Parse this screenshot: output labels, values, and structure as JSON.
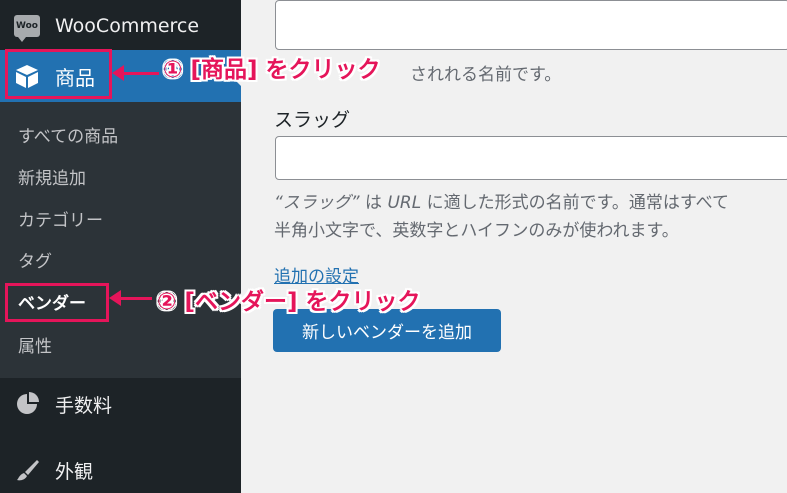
{
  "sidebar": {
    "woocommerce": {
      "badge": "Woo",
      "label": "WooCommerce"
    },
    "products": {
      "label": "商品"
    },
    "submenu": [
      {
        "label": "すべての商品"
      },
      {
        "label": "新規追加"
      },
      {
        "label": "カテゴリー"
      },
      {
        "label": "タグ"
      },
      {
        "label": "ベンダー"
      },
      {
        "label": "属性"
      }
    ],
    "fees": {
      "label": "手数料"
    },
    "appearance": {
      "label": "外観"
    }
  },
  "main": {
    "name_description": "されれる名前です。",
    "slug_label": "スラッグ",
    "slug_description": {
      "quote": "“スラッグ”",
      "p1": " は ",
      "url": "URL",
      "p2": " に適した形式の名前です。通常はすべて",
      "line2": "半角小文字で、英数字とハイフンのみが使われます。"
    },
    "advanced_link": "追加の設定",
    "add_button": "新しいベンダーを追加"
  },
  "annotations": {
    "step1": "① [商品] をクリック",
    "step2": "② [ベンダー] をクリック",
    "color": "#e5155a"
  },
  "colors": {
    "sidebar_bg": "#1d2327",
    "submenu_bg": "#2c3338",
    "accent": "#2271b1",
    "content_bg": "#f1f1f1"
  }
}
